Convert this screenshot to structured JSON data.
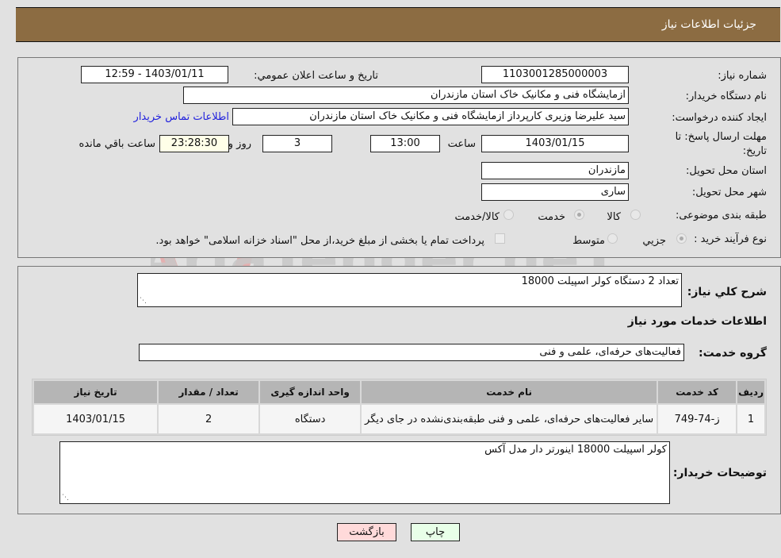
{
  "header": {
    "title": "جزئيات اطلاعات نياز"
  },
  "details": {
    "need_number_label": "شماره نياز:",
    "need_number": "1103001285000003",
    "announce_label": "تاريخ و ساعت اعلان عمومي:",
    "announce_value": "1403/01/11 - 12:59",
    "buyer_org_label": "نام دستگاه خريدار:",
    "buyer_org": "ازمایشگاه فنی و مکانیک خاک استان مازندران",
    "requester_label": "ايجاد کننده درخواست:",
    "requester": "سید علیرضا  وزیری  کارپرداز ازمایشگاه فنی و مکانیک خاک استان مازندران",
    "buyer_contact_link": "اطلاعات تماس خريدار",
    "deadline_label": "مهلت ارسال پاسخ: تا تاريخ:",
    "deadline_date": "1403/01/15",
    "time_label": "ساعت",
    "deadline_time": "13:00",
    "days": "3",
    "days_suffix": "روز و",
    "remaining_time": "23:28:30",
    "remaining_suffix": "ساعت باقي مانده",
    "province_label": "استان محل تحويل:",
    "province": "مازندران",
    "city_label": "شهر محل تحويل:",
    "city": "ساری",
    "category_label": "طبقه بندی موضوعی:",
    "category_options": [
      {
        "label": "کالا",
        "checked": false
      },
      {
        "label": "خدمت",
        "checked": true
      },
      {
        "label": "کالا/خدمت",
        "checked": false
      }
    ],
    "purchase_type_label": "نوع فرآيند خريد :",
    "purchase_type_options": [
      {
        "label": "جزيي",
        "checked": true
      },
      {
        "label": "متوسط",
        "checked": false
      }
    ],
    "treasury_note": "پرداخت تمام يا بخشی از مبلغ خريد،از محل \"اسناد خزانه اسلامی\" خواهد بود.",
    "treasury_checked": false
  },
  "summary": {
    "description_label": "شرح کلي نياز:",
    "description": "تعداد 2 دستگاه کولر اسپیلت 18000",
    "services_heading": "اطلاعات خدمات مورد نياز",
    "service_group_label": "گروه خدمت:",
    "service_group": "فعالیت‌های حرفه‌ای، علمی و فنی"
  },
  "table": {
    "headers": [
      "رديف",
      "کد خدمت",
      "نام خدمت",
      "واحد اندازه گيری",
      "تعداد / مقدار",
      "تاريخ نياز"
    ],
    "rows": [
      [
        "1",
        "ز-74-749",
        "سایر فعالیت‌های حرفه‌ای، علمی و فنی طبقه‌بندی‌نشده در جای دیگر",
        "دستگاه",
        "2",
        "1403/01/15"
      ]
    ]
  },
  "buyer_notes": {
    "label": "توضيحات خريدار:",
    "text": "کولر اسپیلت 18000 اینورتر دار مدل آکس"
  },
  "buttons": {
    "print": "چاپ",
    "back": "بازگشت"
  },
  "watermark": {
    "text": "AriaTender.neT"
  }
}
